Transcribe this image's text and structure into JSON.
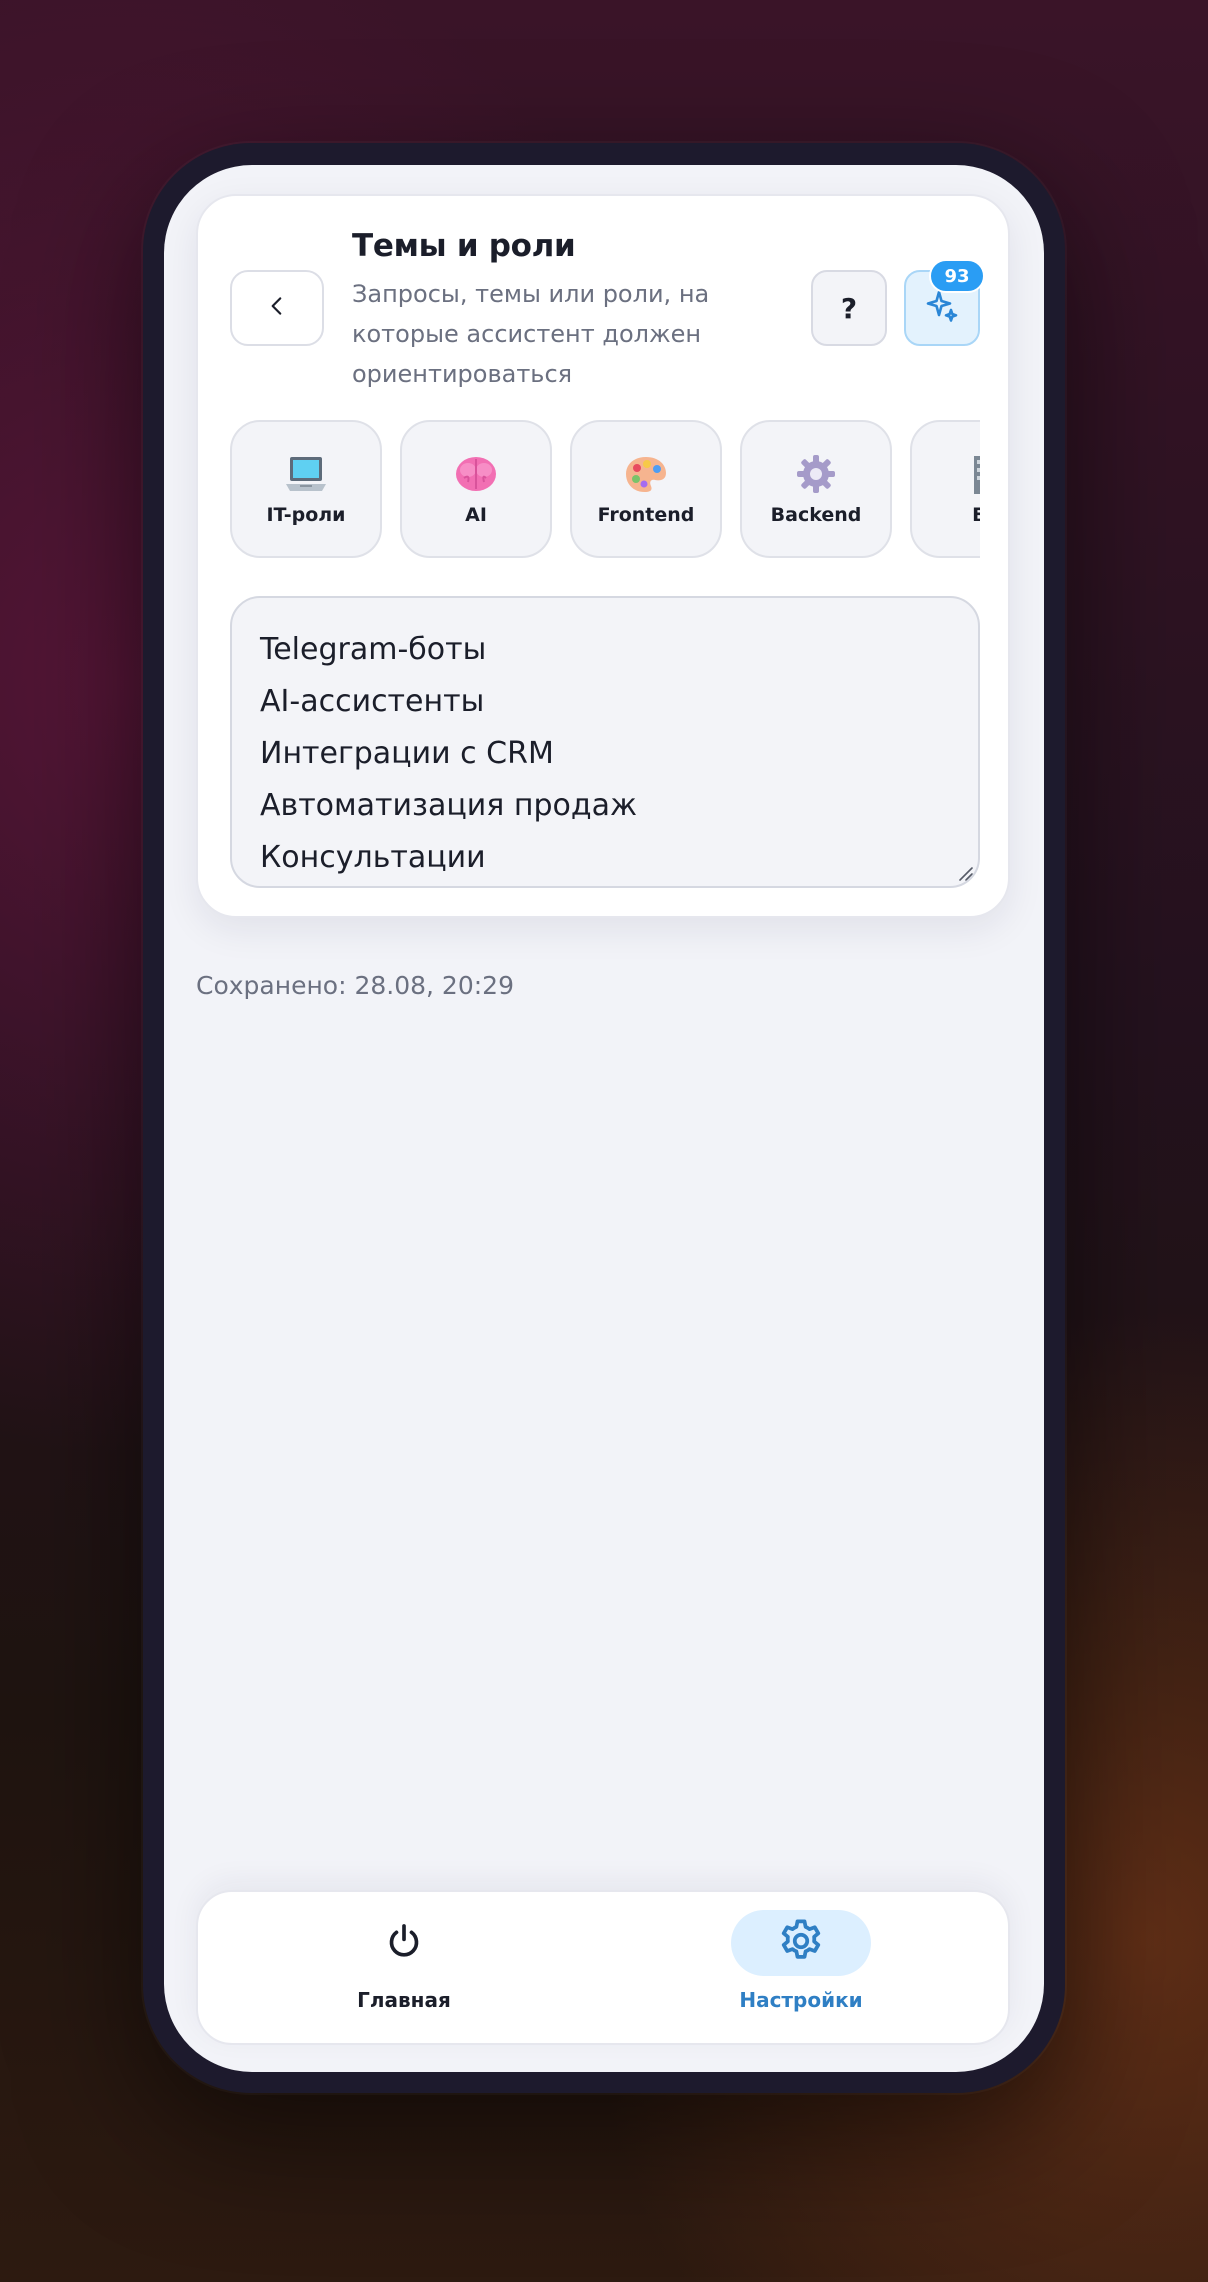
{
  "header": {
    "title": "Темы и роли",
    "subtitle": "Запросы, темы или роли, на которые ассистент должен ориентироваться",
    "back_icon": "chevron-left-icon",
    "help_label": "?",
    "ai_icon": "sparkles-icon",
    "ai_badge_count": "93"
  },
  "chips": [
    {
      "label": "IT-роли",
      "icon": "laptop-icon"
    },
    {
      "label": "AI",
      "icon": "brain-icon"
    },
    {
      "label": "Frontend",
      "icon": "palette-icon"
    },
    {
      "label": "Backend",
      "icon": "gear-icon"
    },
    {
      "label": "Би",
      "icon": "building-icon"
    }
  ],
  "topics": {
    "lines": [
      "Telegram-боты",
      "AI-ассистенты",
      "Интеграции с CRM",
      "Автоматизация продаж",
      "Консультации"
    ]
  },
  "status": {
    "saved_text": "Сохранено: 28.08, 20:29"
  },
  "bottom_nav": {
    "items": [
      {
        "label": "Главная",
        "icon": "power-icon",
        "active": false
      },
      {
        "label": "Настройки",
        "icon": "gear-icon",
        "active": true
      }
    ]
  },
  "colors": {
    "accent": "#2a9df4",
    "active_nav": "#2f7fc4",
    "active_nav_bg": "#dcefff"
  }
}
